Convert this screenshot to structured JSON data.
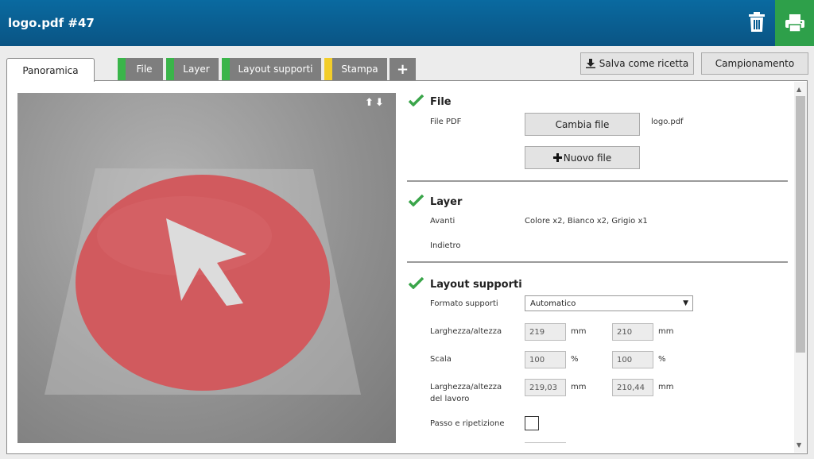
{
  "header": {
    "title": "logo.pdf #47"
  },
  "icons": {
    "trash": "trash-icon",
    "printer": "printer-icon",
    "check": "check-icon",
    "plus": "plus-icon",
    "download": "download-icon"
  },
  "colors": {
    "header": "#0a5e93",
    "print_button": "#2ea04a",
    "tab_gray": "#7e7e7e",
    "tab_green": "#3ab54a",
    "tab_yellow": "#f2cd2a",
    "check_green": "#3aa54a",
    "logo_red": "#d15a5e"
  },
  "tabs": [
    {
      "label": "Panoramica",
      "active": true
    },
    {
      "label": "File",
      "status": "green"
    },
    {
      "label": "Layer",
      "status": "green"
    },
    {
      "label": "Layout supporti",
      "status": "green"
    },
    {
      "label": "Stampa",
      "status": "yellow"
    },
    {
      "label": "+"
    }
  ],
  "toolbar": {
    "save_recipe": "Salva come ricetta",
    "sampling": "Campionamento"
  },
  "preview": {
    "arrows": "⬆⬇"
  },
  "file_section": {
    "title": "File",
    "pdf_label": "File PDF",
    "change_button": "Cambia file",
    "filename": "logo.pdf",
    "new_button": "Nuovo file"
  },
  "layer_section": {
    "title": "Layer",
    "front_label": "Avanti",
    "front_value": "Colore x2, Bianco x2, Grigio x1",
    "back_label": "Indietro"
  },
  "layout_section": {
    "title": "Layout supporti",
    "media_format_label": "Formato supporti",
    "media_format_value": "Automatico",
    "width_height_label": "Larghezza/altezza",
    "width": "219",
    "height": "210",
    "unit_mm": "mm",
    "scale_label": "Scala",
    "scale_x": "100",
    "scale_y": "100",
    "unit_pct": "%",
    "job_size_label_1": "Larghezza/altezza",
    "job_size_label_2": "del lavoro",
    "job_width": "219,03",
    "job_height": "210,44",
    "step_repeat_label": "Passo e ripetizione"
  }
}
